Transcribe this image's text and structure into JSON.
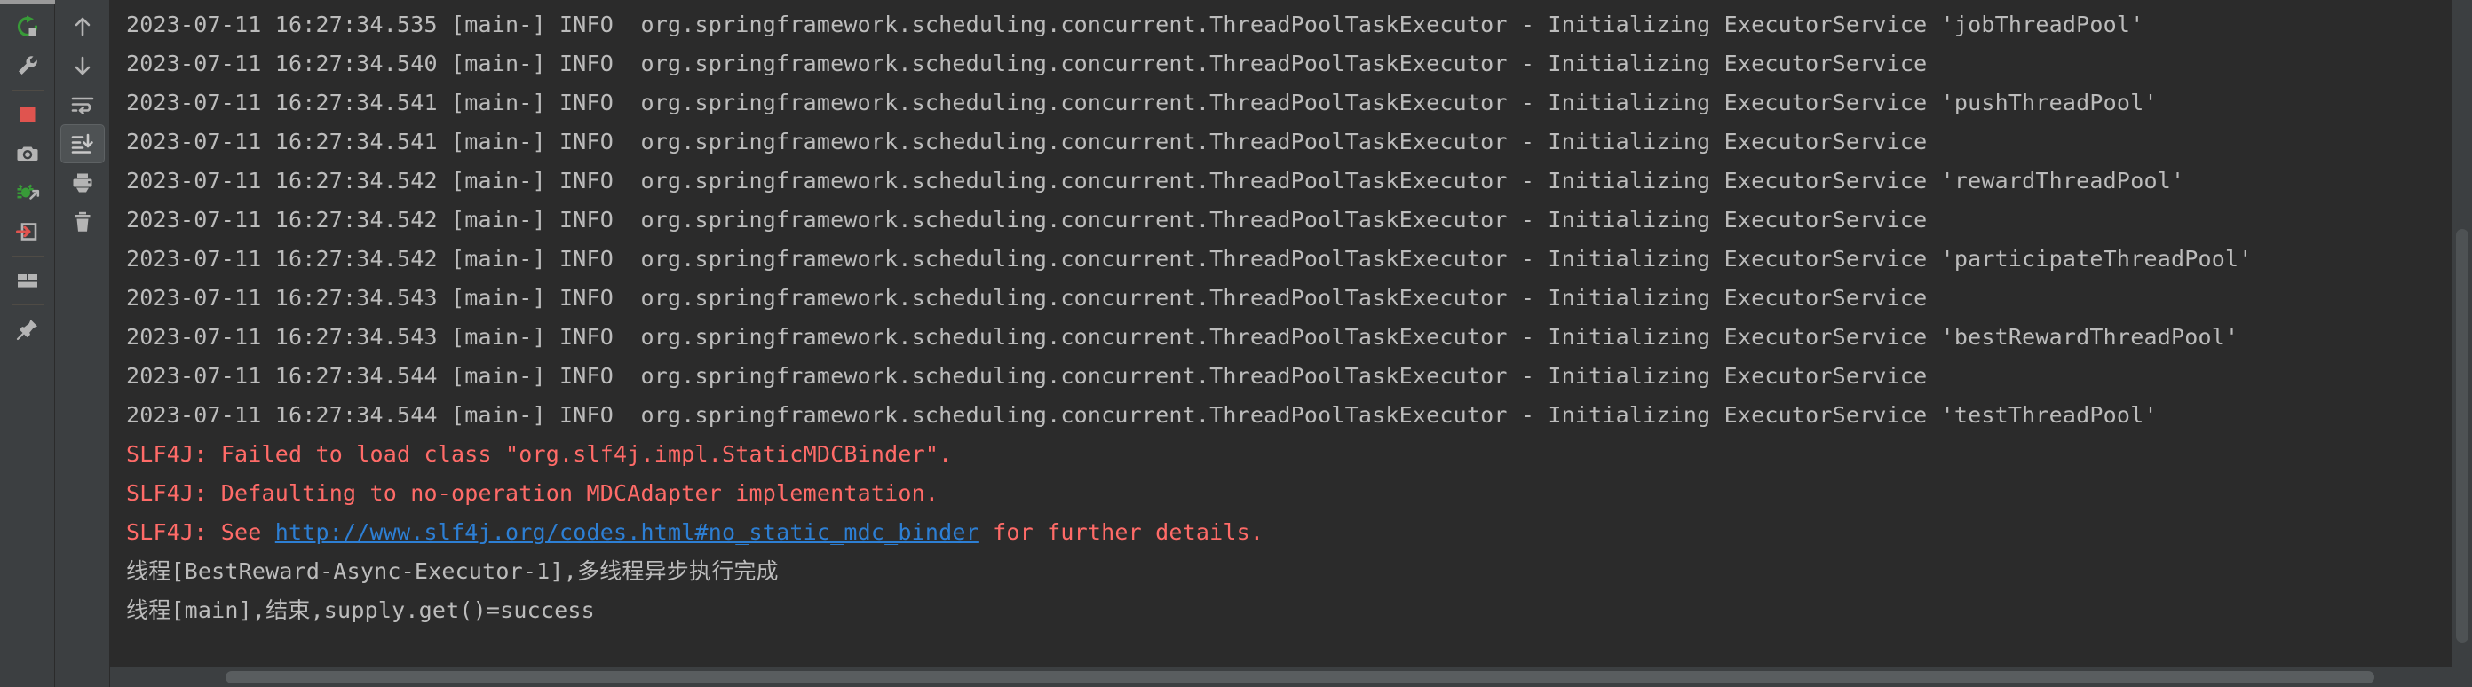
{
  "window": {
    "background_color": "#2b2b2b",
    "toolbar_color": "#3c3f41",
    "text_color": "#bcbcbc",
    "error_color": "#ff6b68",
    "link_color": "#2d7fd4"
  },
  "left_toolbar": {
    "items": [
      {
        "name": "rerun-icon",
        "label": "Rerun",
        "type": "button"
      },
      {
        "name": "wrench-icon",
        "label": "Edit Configuration",
        "type": "button"
      },
      {
        "name": "separator-1",
        "label": "",
        "type": "separator"
      },
      {
        "name": "stop-icon",
        "label": "Stop",
        "type": "button"
      },
      {
        "name": "camera-icon",
        "label": "Snapshot",
        "type": "button"
      },
      {
        "name": "debug-attach-icon",
        "label": "Attach Debugger",
        "type": "button"
      },
      {
        "name": "thread-dump-icon",
        "label": "Dump Threads",
        "type": "button"
      },
      {
        "name": "separator-2",
        "label": "",
        "type": "separator"
      },
      {
        "name": "layout-icon",
        "label": "Layout Settings",
        "type": "button"
      },
      {
        "name": "separator-3",
        "label": "",
        "type": "separator"
      },
      {
        "name": "pin-icon",
        "label": "Pin Tab",
        "type": "button"
      }
    ]
  },
  "right_toolbar": {
    "items": [
      {
        "name": "arrow-up-icon",
        "label": "Up the Stack Trace",
        "type": "button",
        "active": false
      },
      {
        "name": "arrow-down-icon",
        "label": "Down the Stack Trace",
        "type": "button",
        "active": false
      },
      {
        "name": "soft-wrap-icon",
        "label": "Use Soft Wraps",
        "type": "button",
        "active": false
      },
      {
        "name": "scroll-to-end-icon",
        "label": "Scroll to End",
        "type": "button",
        "active": true
      },
      {
        "name": "print-icon",
        "label": "Print",
        "type": "button",
        "active": false
      },
      {
        "name": "trash-icon",
        "label": "Clear All",
        "type": "button",
        "active": false
      }
    ]
  },
  "console": {
    "lines": [
      {
        "kind": "info",
        "text": "2023-07-11 16:27:34.535 [main-] INFO  org.springframework.scheduling.concurrent.ThreadPoolTaskExecutor - Initializing ExecutorService 'jobThreadPool'"
      },
      {
        "kind": "info",
        "text": "2023-07-11 16:27:34.540 [main-] INFO  org.springframework.scheduling.concurrent.ThreadPoolTaskExecutor - Initializing ExecutorService"
      },
      {
        "kind": "info",
        "text": "2023-07-11 16:27:34.541 [main-] INFO  org.springframework.scheduling.concurrent.ThreadPoolTaskExecutor - Initializing ExecutorService 'pushThreadPool'"
      },
      {
        "kind": "info",
        "text": "2023-07-11 16:27:34.541 [main-] INFO  org.springframework.scheduling.concurrent.ThreadPoolTaskExecutor - Initializing ExecutorService"
      },
      {
        "kind": "info",
        "text": "2023-07-11 16:27:34.542 [main-] INFO  org.springframework.scheduling.concurrent.ThreadPoolTaskExecutor - Initializing ExecutorService 'rewardThreadPool'"
      },
      {
        "kind": "info",
        "text": "2023-07-11 16:27:34.542 [main-] INFO  org.springframework.scheduling.concurrent.ThreadPoolTaskExecutor - Initializing ExecutorService"
      },
      {
        "kind": "info",
        "text": "2023-07-11 16:27:34.542 [main-] INFO  org.springframework.scheduling.concurrent.ThreadPoolTaskExecutor - Initializing ExecutorService 'participateThreadPool'"
      },
      {
        "kind": "info",
        "text": "2023-07-11 16:27:34.543 [main-] INFO  org.springframework.scheduling.concurrent.ThreadPoolTaskExecutor - Initializing ExecutorService"
      },
      {
        "kind": "info",
        "text": "2023-07-11 16:27:34.543 [main-] INFO  org.springframework.scheduling.concurrent.ThreadPoolTaskExecutor - Initializing ExecutorService 'bestRewardThreadPool'"
      },
      {
        "kind": "info",
        "text": "2023-07-11 16:27:34.544 [main-] INFO  org.springframework.scheduling.concurrent.ThreadPoolTaskExecutor - Initializing ExecutorService"
      },
      {
        "kind": "info",
        "text": "2023-07-11 16:27:34.544 [main-] INFO  org.springframework.scheduling.concurrent.ThreadPoolTaskExecutor - Initializing ExecutorService 'testThreadPool'"
      },
      {
        "kind": "error",
        "text": "SLF4J: Failed to load class \"org.slf4j.impl.StaticMDCBinder\"."
      },
      {
        "kind": "error",
        "text": "SLF4J: Defaulting to no-operation MDCAdapter implementation."
      },
      {
        "kind": "error-link",
        "prefix": "SLF4J: See ",
        "link": "http://www.slf4j.org/codes.html#no_static_mdc_binder",
        "suffix": " for further details."
      },
      {
        "kind": "plain",
        "text": "线程[BestReward-Async-Executor-1],多线程异步执行完成"
      },
      {
        "kind": "plain",
        "text": "线程[main],结束,supply.get()=success"
      }
    ]
  },
  "scrollbars": {
    "vertical_name": "vertical-scrollbar",
    "horizontal_name": "horizontal-scrollbar"
  }
}
